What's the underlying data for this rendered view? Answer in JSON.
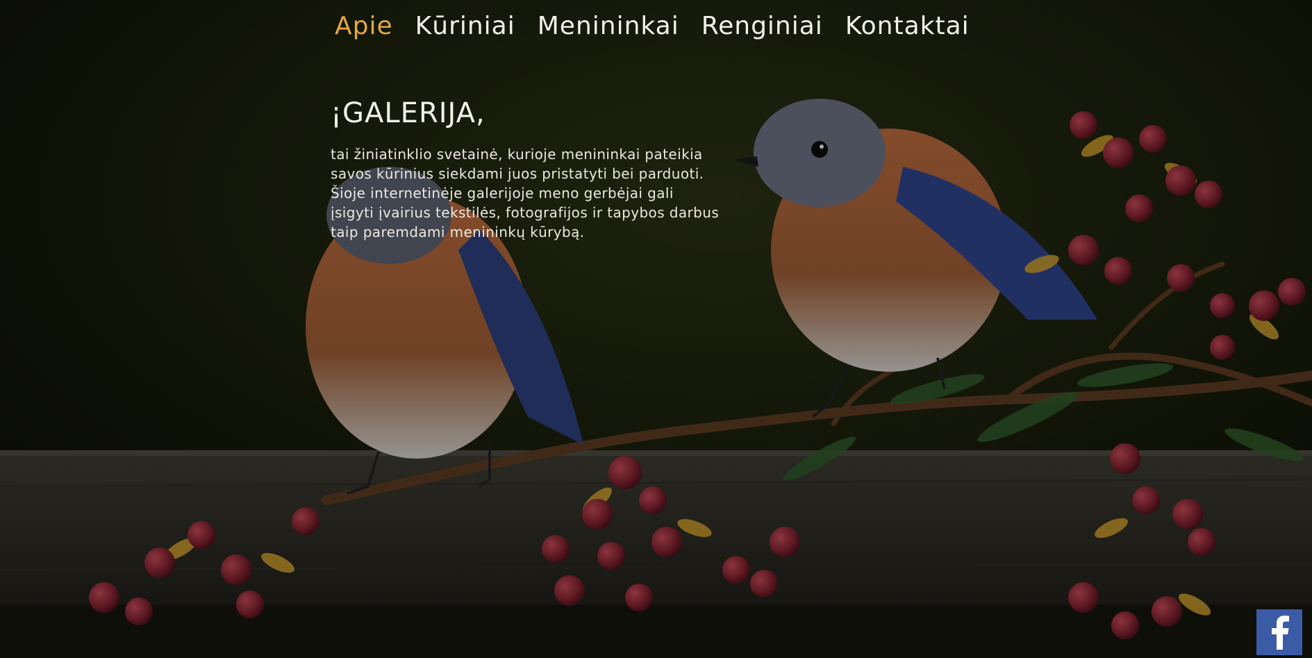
{
  "nav": {
    "items": [
      {
        "label": "Apie",
        "active": true
      },
      {
        "label": "Kūriniai",
        "active": false
      },
      {
        "label": "Menininkai",
        "active": false
      },
      {
        "label": "Renginiai",
        "active": false
      },
      {
        "label": "Kontaktai",
        "active": false
      }
    ]
  },
  "main": {
    "title": "¡GALERIJA,",
    "description": "tai žiniatinklio svetainė, kurioje menininkai pateikia savos kūrinius siekdami juos pristatyti bei parduoti. Šioje internetinėje galerijoje meno gerbėjai gali įsigyti įvairius tekstilės, fotografijos ir tapybos darbus taip paremdami menininkų kūrybą."
  },
  "social": {
    "facebook_icon": "facebook-icon"
  },
  "colors": {
    "accent": "#e3a93c",
    "text": "#f3f1ea",
    "facebook": "#3b5ba6"
  }
}
